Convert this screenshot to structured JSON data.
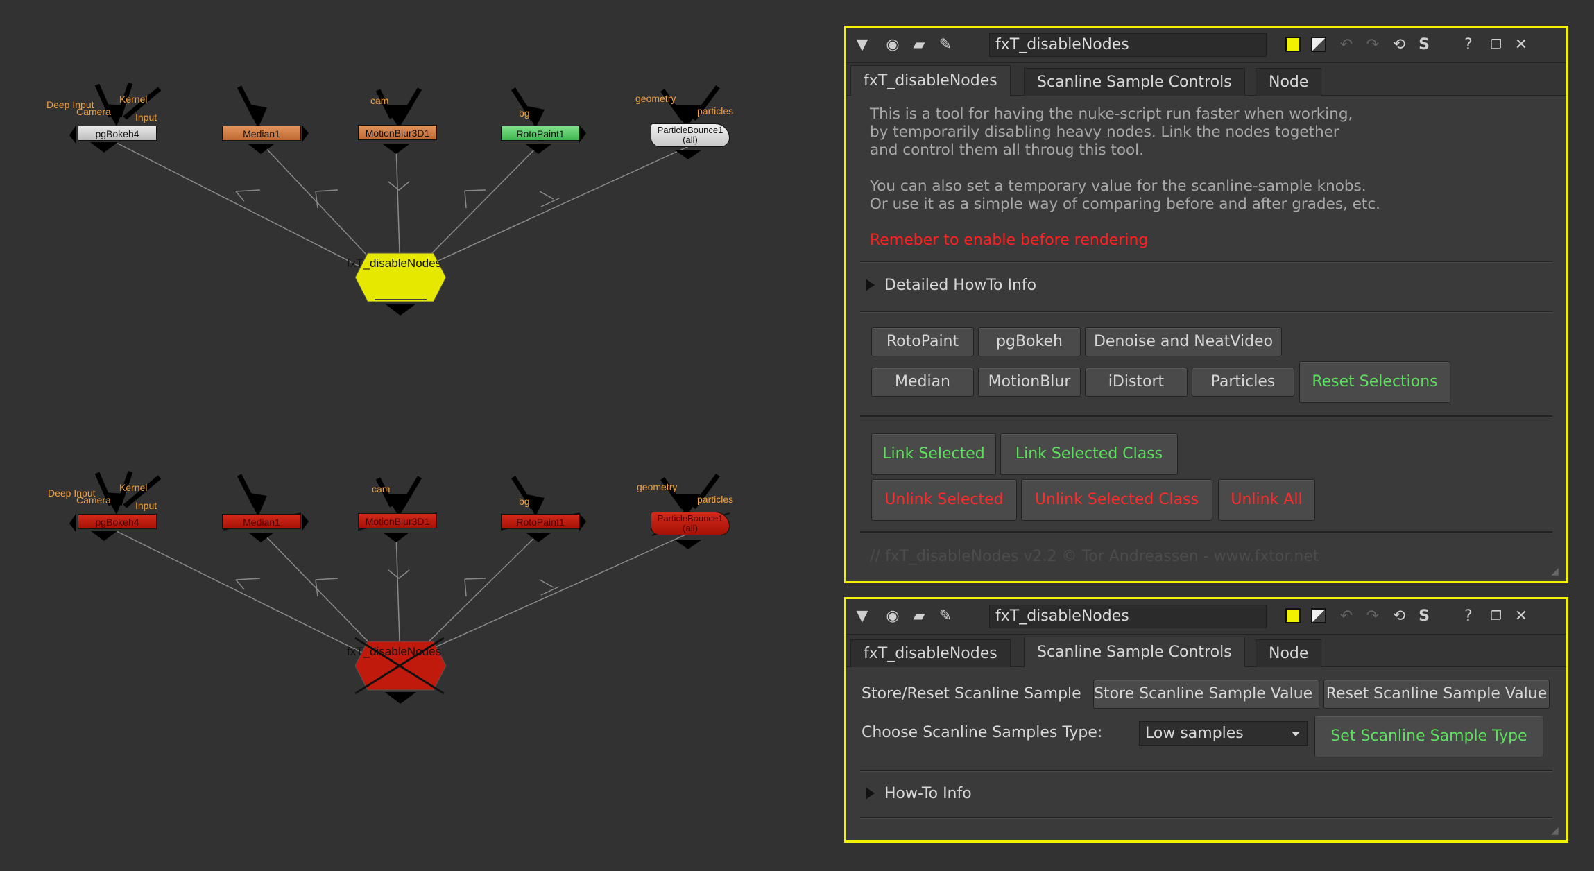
{
  "graph": {
    "top_row": {
      "nodes": [
        "pgBokeh4",
        "Median1",
        "MotionBlur3D1",
        "RotoPaint1",
        "ParticleBounce1\n(all)"
      ],
      "main": "fxT_disableNodes"
    },
    "bottom_row": {
      "nodes": [
        "pgBokeh4",
        "Median1",
        "MotionBlur3D1",
        "RotoPaint1",
        "ParticleBounce1\n(all)"
      ],
      "main": "fxT_disableNodes"
    },
    "input_labels": {
      "deep_input": "Deep Input",
      "camera": "Camera",
      "kernel": "Kernel",
      "input": "Input",
      "cam": "cam",
      "bg": "bg",
      "geometry": "geometry",
      "particles": "particles"
    },
    "colors": {
      "yellow": "#e6e800",
      "red": "#c01a0c",
      "edge": "#8a8a8a"
    }
  },
  "panel1": {
    "name": "fxT_disableNodes",
    "tabs": [
      "fxT_disableNodes",
      "Scanline Sample Controls",
      "Node"
    ],
    "description": [
      "This is a tool for having the nuke-script run faster when working,",
      "by temporarily disabling heavy nodes. Link the nodes together",
      "and control them all throug this tool.",
      "You can also set a temporary value for the scanline-sample knobs.",
      "Or use it as a simple way of comparing before and after grades, etc."
    ],
    "warning": "Remeber to enable before rendering",
    "howto": "Detailed HowTo Info",
    "class_buttons": [
      "RotoPaint",
      "pgBokeh",
      "Denoise and NeatVideo",
      "Median",
      "MotionBlur",
      "iDistort",
      "Particles"
    ],
    "reset_selections": "Reset Selections",
    "link_selected": "Link Selected",
    "link_selected_class": "Link Selected Class",
    "unlink_selected": "Unlink Selected",
    "unlink_selected_class": "Unlink Selected Class",
    "unlink_all": "Unlink All",
    "footer": "// fxT_disableNodes v2.2 © Tor Andreassen - www.fxtor.net"
  },
  "panel2": {
    "name": "fxT_disableNodes",
    "tabs": [
      "fxT_disableNodes",
      "Scanline Sample Controls",
      "Node"
    ],
    "store_reset_label": "Store/Reset Scanline Sample",
    "store_button": "Store Scanline Sample Value",
    "reset_button": "Reset Scanline Sample Value",
    "choose_label": "Choose Scanline Samples Type:",
    "select_value": "Low samples",
    "set_button": "Set Scanline Sample Type",
    "howto": "How-To Info"
  },
  "toolbar_icons": [
    "collapse-triangle-icon",
    "settings-circle-icon",
    "film-icon",
    "wrench-icon",
    "yellow-color-swatch",
    "gray-color-swatch",
    "undo-icon",
    "redo-icon",
    "revert-icon",
    "s-icon",
    "help-icon",
    "float-icon",
    "close-icon"
  ]
}
